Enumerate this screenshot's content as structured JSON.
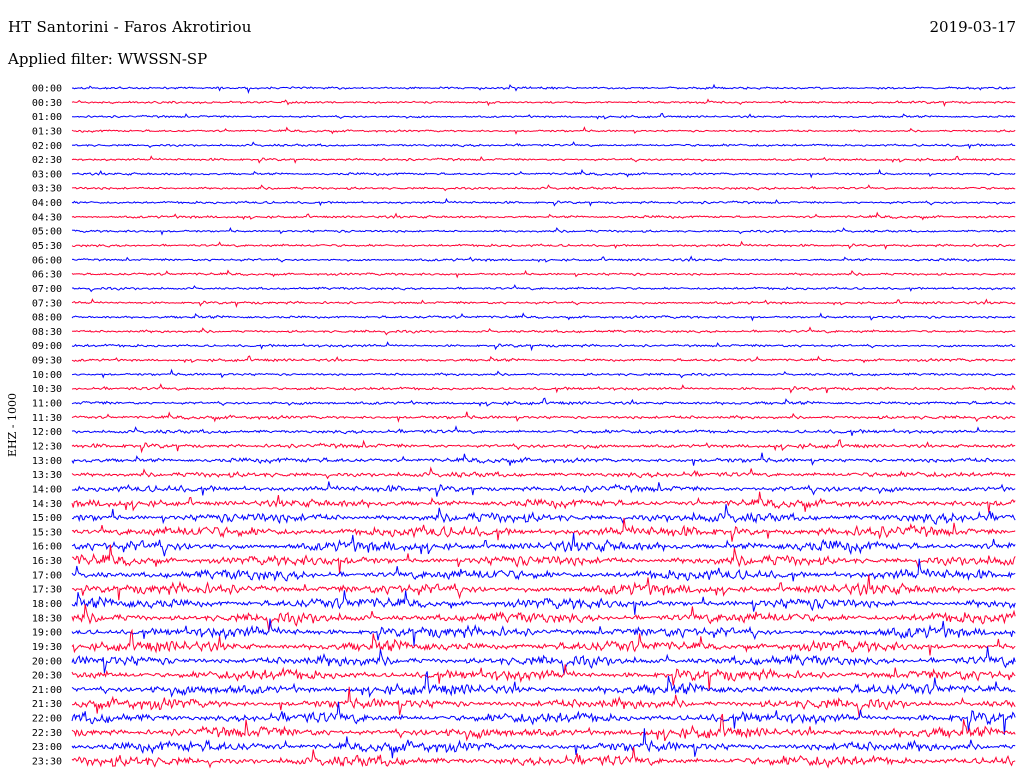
{
  "header": {
    "station": "HT Santorini - Faros Akrotiriou",
    "date": "2019-03-17",
    "filter_label": "Applied filter: WWSSN-SP"
  },
  "chart_data": {
    "type": "line",
    "title": "HT Santorini - Faros Akrotiriou",
    "ylabel": "EHZ - 1000",
    "xlabel": "",
    "trace_colors": [
      "#0000ff",
      "#ff0033"
    ],
    "rows": [
      {
        "label": "00:00",
        "amplitude": 0.25
      },
      {
        "label": "00:30",
        "amplitude": 0.25
      },
      {
        "label": "01:00",
        "amplitude": 0.25
      },
      {
        "label": "01:30",
        "amplitude": 0.25
      },
      {
        "label": "02:00",
        "amplitude": 0.27
      },
      {
        "label": "02:30",
        "amplitude": 0.27
      },
      {
        "label": "03:00",
        "amplitude": 0.27
      },
      {
        "label": "03:30",
        "amplitude": 0.28
      },
      {
        "label": "04:00",
        "amplitude": 0.28
      },
      {
        "label": "04:30",
        "amplitude": 0.28
      },
      {
        "label": "05:00",
        "amplitude": 0.28
      },
      {
        "label": "05:30",
        "amplitude": 0.28
      },
      {
        "label": "06:00",
        "amplitude": 0.28
      },
      {
        "label": "06:30",
        "amplitude": 0.28
      },
      {
        "label": "07:00",
        "amplitude": 0.28
      },
      {
        "label": "07:30",
        "amplitude": 0.28
      },
      {
        "label": "08:00",
        "amplitude": 0.3
      },
      {
        "label": "08:30",
        "amplitude": 0.3
      },
      {
        "label": "09:00",
        "amplitude": 0.3
      },
      {
        "label": "09:30",
        "amplitude": 0.3
      },
      {
        "label": "10:00",
        "amplitude": 0.3
      },
      {
        "label": "10:30",
        "amplitude": 0.32
      },
      {
        "label": "11:00",
        "amplitude": 0.35
      },
      {
        "label": "11:30",
        "amplitude": 0.38
      },
      {
        "label": "12:00",
        "amplitude": 0.4
      },
      {
        "label": "12:30",
        "amplitude": 0.45
      },
      {
        "label": "13:00",
        "amplitude": 0.5
      },
      {
        "label": "13:30",
        "amplitude": 0.55
      },
      {
        "label": "14:00",
        "amplitude": 0.65
      },
      {
        "label": "14:30",
        "amplitude": 0.75
      },
      {
        "label": "15:00",
        "amplitude": 0.95
      },
      {
        "label": "15:30",
        "amplitude": 1.0
      },
      {
        "label": "16:00",
        "amplitude": 1.0
      },
      {
        "label": "16:30",
        "amplitude": 1.0
      },
      {
        "label": "17:00",
        "amplitude": 1.0
      },
      {
        "label": "17:30",
        "amplitude": 1.0
      },
      {
        "label": "18:00",
        "amplitude": 1.0
      },
      {
        "label": "18:30",
        "amplitude": 1.0
      },
      {
        "label": "19:00",
        "amplitude": 1.0
      },
      {
        "label": "19:30",
        "amplitude": 1.0
      },
      {
        "label": "20:00",
        "amplitude": 1.0
      },
      {
        "label": "20:30",
        "amplitude": 1.0
      },
      {
        "label": "21:00",
        "amplitude": 1.0
      },
      {
        "label": "21:30",
        "amplitude": 1.0
      },
      {
        "label": "22:00",
        "amplitude": 1.0
      },
      {
        "label": "22:30",
        "amplitude": 1.0
      },
      {
        "label": "23:00",
        "amplitude": 1.0
      },
      {
        "label": "23:30",
        "amplitude": 1.0
      }
    ],
    "grid": false,
    "legend": "none"
  }
}
